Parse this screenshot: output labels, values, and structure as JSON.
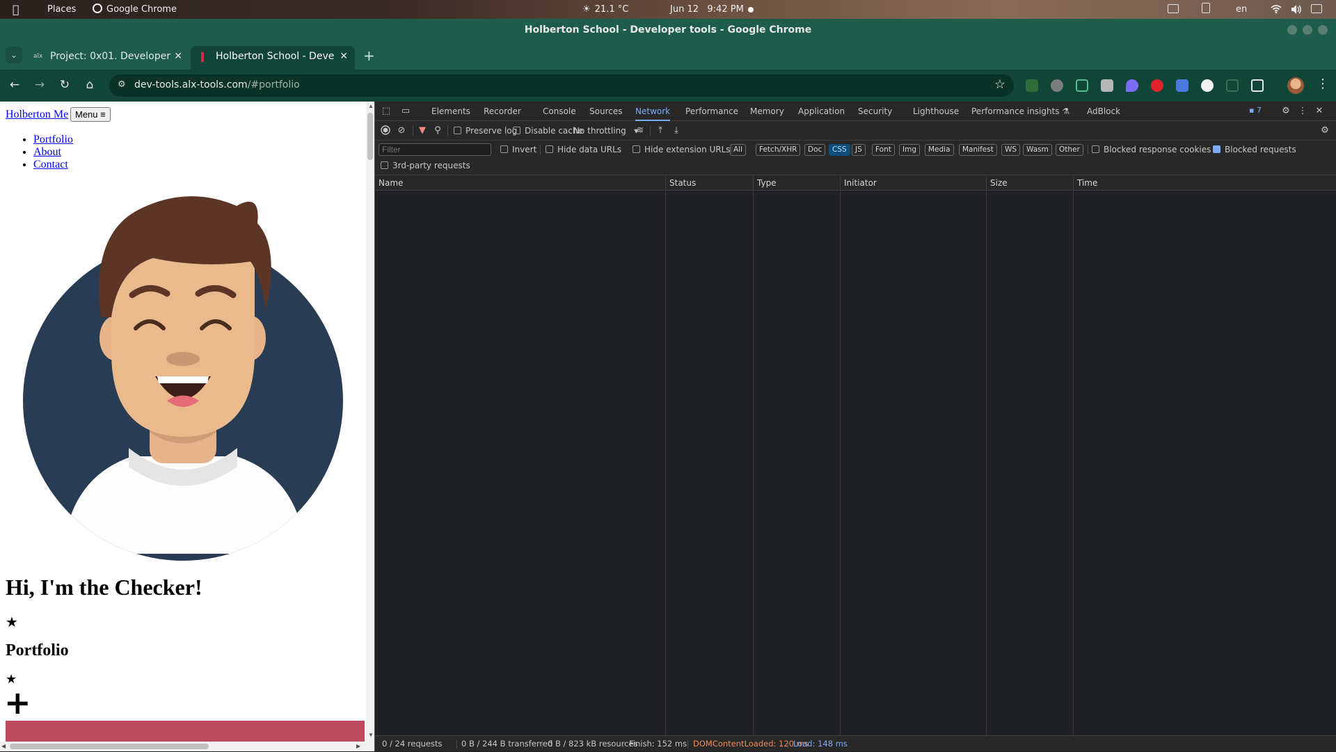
{
  "topbar": {
    "places": "Places",
    "app": "Google Chrome",
    "weather": "21.1 °C",
    "date": "Jun 12",
    "time": "9:42 PM",
    "lang": "en"
  },
  "window": {
    "title": "Holberton School - Developer tools - Google Chrome"
  },
  "tabs": [
    {
      "title": "Project: 0x01. Developer",
      "icon": "alx-favicon"
    },
    {
      "title": "Holberton School - Deve",
      "icon": "holberton-favicon",
      "active": true
    }
  ],
  "address": {
    "host": "dev-tools.alx-tools.com",
    "path": "/#portfolio"
  },
  "page": {
    "brand": "Holberton Me",
    "menu_label": "Menu",
    "menu_icon": "≡",
    "nav": [
      "Portfolio",
      "About",
      "Contact"
    ],
    "hero_title": "Hi, I'm the Checker!",
    "star": "★",
    "section_title": "Portfolio",
    "plus": "+",
    "accent_color": "#bd4b5f"
  },
  "devtools": {
    "tabs": [
      "Elements",
      "Recorder",
      "Console",
      "Sources",
      "Network",
      "Performance",
      "Memory",
      "Application",
      "Security",
      "Lighthouse",
      "Performance insights",
      "AdBlock"
    ],
    "active_tab": "Network",
    "issues_count": "7",
    "toolbar": {
      "preserve_log": "Preserve log",
      "disable_cache": "Disable cache",
      "throttling": "No throttling"
    },
    "filter": {
      "placeholder": "Filter",
      "invert": "Invert",
      "hide_data_urls": "Hide data URLs",
      "hide_extension_urls": "Hide extension URLs",
      "types": [
        "All",
        "Fetch/XHR",
        "Doc",
        "CSS",
        "JS",
        "Font",
        "Img",
        "Media",
        "Manifest",
        "WS",
        "Wasm",
        "Other"
      ],
      "active_type": "CSS",
      "blocked_response_cookies": "Blocked response cookies",
      "blocked_requests": "Blocked requests",
      "third_party": "3rd-party requests"
    },
    "columns": [
      "Name",
      "Status",
      "Type",
      "Initiator",
      "Size",
      "Time"
    ],
    "status": {
      "requests": "0 / 24 requests",
      "transferred": "0 B / 244 B transferred",
      "resources": "0 B / 823 kB resources",
      "finish": "Finish: 152 ms",
      "dom_loaded": "DOMContentLoaded: 120 ms",
      "load": "Load: 148 ms",
      "dom_color": "#f28b54",
      "load_color": "#7cacf8"
    }
  }
}
